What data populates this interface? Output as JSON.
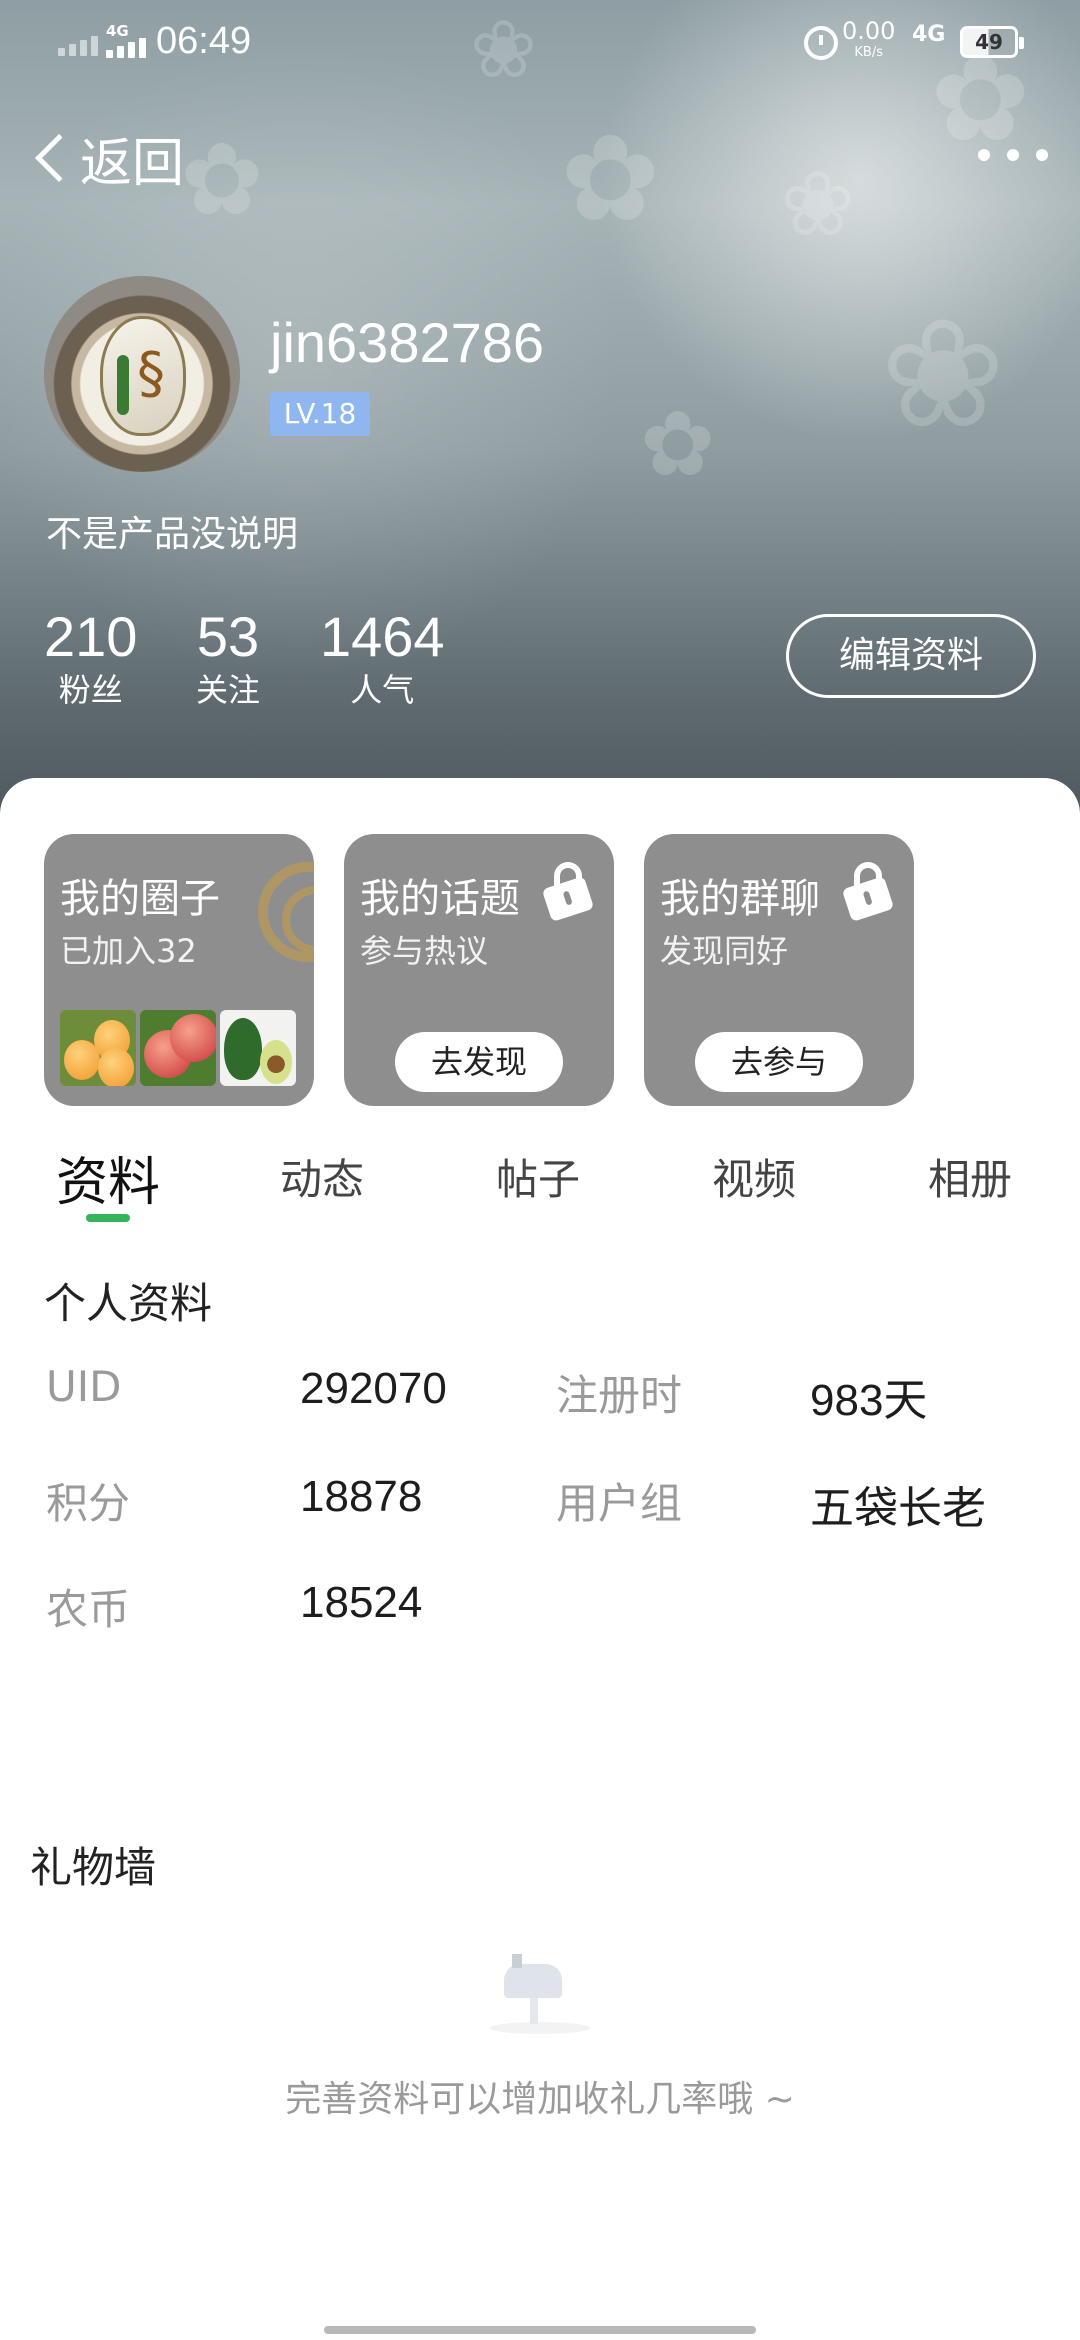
{
  "status_bar": {
    "network_left": "4G",
    "time": "06:49",
    "speed_value": "0.00",
    "speed_unit": "KB/s",
    "network_right": "4G",
    "battery": "49"
  },
  "header": {
    "back_label": "返回",
    "more_icon": "more-icon"
  },
  "profile": {
    "username": "jin6382786",
    "level": "LV.18",
    "signature": "不是产品没说明",
    "stats": [
      {
        "value": "210",
        "label": "粉丝"
      },
      {
        "value": "53",
        "label": "关注"
      },
      {
        "value": "1464",
        "label": "人气"
      }
    ],
    "edit_button": "编辑资料"
  },
  "cards": [
    {
      "title": "我的圈子",
      "subtitle": "已加入32"
    },
    {
      "title": "我的话题",
      "subtitle": "参与热议",
      "button": "去发现"
    },
    {
      "title": "我的群聊",
      "subtitle": "发现同好",
      "button": "去参与"
    }
  ],
  "tabs": [
    "资料",
    "动态",
    "帖子",
    "视频",
    "相册"
  ],
  "active_tab_color": "#34b45b",
  "personal_info": {
    "title": "个人资料",
    "fields": [
      {
        "label": "UID",
        "value": "292070"
      },
      {
        "label": "注册时",
        "value": "983天"
      },
      {
        "label": "积分",
        "value": "18878"
      },
      {
        "label": "用户组",
        "value": "五袋长老"
      },
      {
        "label": "农币",
        "value": "18524"
      }
    ]
  },
  "gift_wall": {
    "title": "礼物墙",
    "empty_hint": "完善资料可以增加收礼几率哦 ~"
  }
}
